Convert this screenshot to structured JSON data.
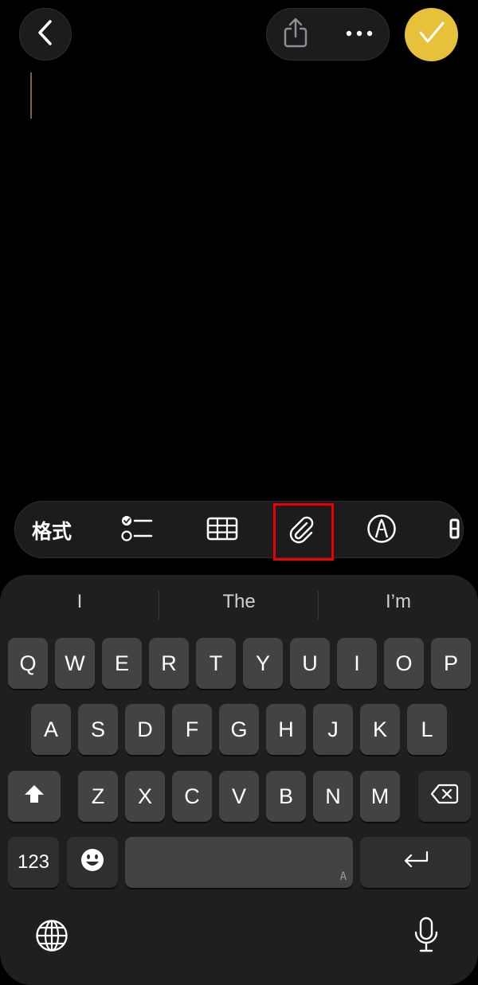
{
  "header": {
    "back_icon": "chevron-left-icon",
    "share_icon": "share-icon",
    "more_icon": "ellipsis-icon",
    "done_icon": "checkmark-icon",
    "accent": "#e8c13b"
  },
  "toolbar": {
    "format_label": "格式",
    "items": [
      "checklist-icon",
      "table-icon",
      "paperclip-icon",
      "markup-pen-icon",
      "more-icon"
    ]
  },
  "keyboard": {
    "suggestions": [
      "I",
      "The",
      "I’m"
    ],
    "row1": [
      "Q",
      "W",
      "E",
      "R",
      "T",
      "Y",
      "U",
      "I",
      "O",
      "P"
    ],
    "row2": [
      "A",
      "S",
      "D",
      "F",
      "G",
      "H",
      "J",
      "K",
      "L"
    ],
    "row3": [
      "Z",
      "X",
      "C",
      "V",
      "B",
      "N",
      "M"
    ],
    "numbers_label": "123",
    "space_hint": "A",
    "shift_icon": "shift-icon",
    "delete_icon": "delete-icon",
    "return_icon": "return-icon",
    "emoji_icon": "emoji-icon",
    "globe_icon": "globe-icon",
    "mic_icon": "microphone-icon"
  }
}
